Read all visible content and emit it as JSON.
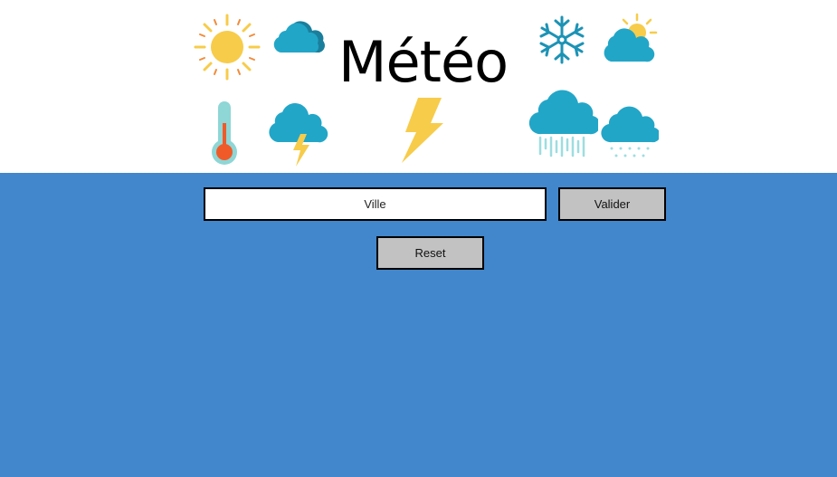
{
  "header": {
    "title": "Météo",
    "icons": [
      "sun-icon",
      "cloud-icon",
      "snowflake-icon",
      "sun-cloud-icon",
      "thermometer-icon",
      "storm-cloud-icon",
      "lightning-icon",
      "rain-cloud-icon",
      "snow-cloud-icon"
    ]
  },
  "search": {
    "placeholder": "Ville",
    "value": ""
  },
  "buttons": {
    "validate_label": "Valider",
    "reset_label": "Reset"
  },
  "colors": {
    "background": "#4286cc",
    "header": "#ffffff",
    "button": "#c2c2c2",
    "cloud": "#22a6c8",
    "sun": "#f7cc4a"
  }
}
